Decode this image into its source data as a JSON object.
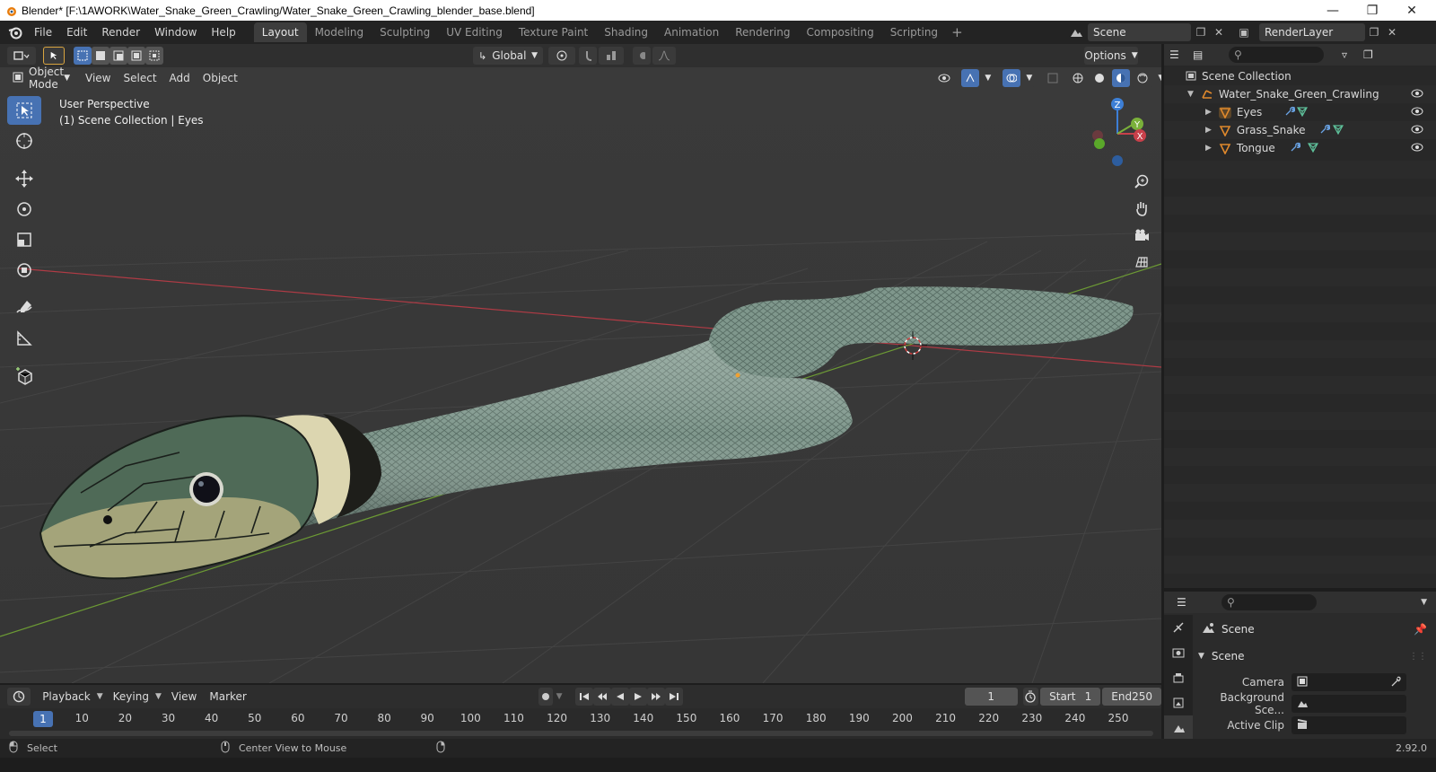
{
  "window": {
    "title": "Blender* [F:\\1AWORK\\Water_Snake_Green_Crawling/Water_Snake_Green_Crawling_blender_base.blend]",
    "controls": [
      "minimize-icon",
      "restore-icon",
      "close-icon"
    ]
  },
  "menu": {
    "items": [
      "File",
      "Edit",
      "Render",
      "Window",
      "Help"
    ]
  },
  "workspaces": {
    "tabs": [
      "Layout",
      "Modeling",
      "Sculpting",
      "UV Editing",
      "Texture Paint",
      "Shading",
      "Animation",
      "Rendering",
      "Compositing",
      "Scripting"
    ],
    "active": "Layout",
    "add_label": "+"
  },
  "scene_selector": {
    "scene": "Scene",
    "view_layer": "RenderLayer"
  },
  "viewport": {
    "mode": "Object Mode",
    "menus": [
      "View",
      "Select",
      "Add",
      "Object"
    ],
    "transform_orientation": "Global",
    "options_label": "Options",
    "info_line1": "User Perspective",
    "info_line2": "(1) Scene Collection | Eyes",
    "gizmo_axes": {
      "z": "Z",
      "y": "Y",
      "x": "X"
    }
  },
  "outliner": {
    "root": "Scene Collection",
    "collection": "Water_Snake_Green_Crawling",
    "objects": [
      "Eyes",
      "Grass_Snake",
      "Tongue"
    ]
  },
  "properties": {
    "header": "Scene",
    "panel_title": "Scene",
    "camera_label": "Camera",
    "background_label": "Background Sce...",
    "active_clip_label": "Active Clip"
  },
  "timeline": {
    "menus": [
      "Playback",
      "Keying",
      "View",
      "Marker"
    ],
    "current_frame": "1",
    "start_label": "Start",
    "start_value": "1",
    "end_label": "End",
    "end_value": "250",
    "ruler_labels": [
      "1",
      "10",
      "20",
      "30",
      "40",
      "50",
      "60",
      "70",
      "80",
      "90",
      "100",
      "110",
      "120",
      "130",
      "140",
      "150",
      "160",
      "170",
      "180",
      "190",
      "200",
      "210",
      "220",
      "230",
      "240",
      "250"
    ]
  },
  "status": {
    "left": "Select",
    "middle": "Center View to Mouse",
    "version": "2.92.0"
  },
  "colors": {
    "accent": "#4772b3",
    "viewport_bg": "#393939",
    "snake_body": "#7f978c",
    "snake_collar": "#dcd6b0",
    "x_axis": "#c8404a",
    "y_axis": "#7ab03a",
    "z_axis": "#3d7fd6"
  }
}
